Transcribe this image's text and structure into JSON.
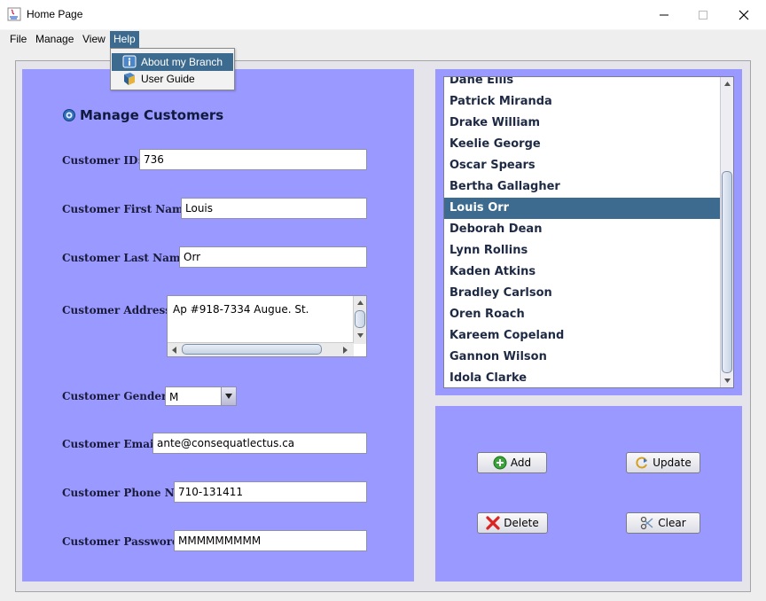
{
  "window": {
    "title": "Home Page"
  },
  "menubar": {
    "items": [
      {
        "label": "File"
      },
      {
        "label": "Manage"
      },
      {
        "label": "View"
      },
      {
        "label": "Help"
      }
    ]
  },
  "help_menu": {
    "items": [
      {
        "label": "About my Branch"
      },
      {
        "label": "User Guide"
      }
    ]
  },
  "form": {
    "title": "Manage Customers",
    "customer_id": {
      "label": "Customer ID:",
      "value": "736"
    },
    "first_name": {
      "label": "Customer First Name:",
      "value": "Louis"
    },
    "last_name": {
      "label": "Customer Last Name:",
      "value": "Orr"
    },
    "address": {
      "label": "Customer Address:",
      "value": "Ap #918-7334 Augue. St."
    },
    "gender": {
      "label": "Customer Gender:",
      "value": "M"
    },
    "email": {
      "label": "Customer Email:",
      "value": "ante@consequatlectus.ca"
    },
    "phone": {
      "label": "Customer Phone N°:",
      "value": "710-131411"
    },
    "password": {
      "label": "Customer Password:",
      "value": "MMMMMMMMM"
    }
  },
  "customer_list": {
    "items": [
      "Dane Ellis",
      "Patrick Miranda",
      "Drake William",
      "Keelie George",
      "Oscar Spears",
      "Bertha Gallagher",
      "Louis Orr",
      "Deborah Dean",
      "Lynn Rollins",
      "Kaden Atkins",
      "Bradley Carlson",
      "Oren Roach",
      "Kareem Copeland",
      "Gannon Wilson",
      "Idola Clarke"
    ],
    "selected": "Louis Orr"
  },
  "actions": {
    "add": "Add",
    "update": "Update",
    "delete": "Delete",
    "clear": "Clear"
  },
  "colors": {
    "panel": "#9999ff",
    "selection": "#3d6b8f"
  }
}
